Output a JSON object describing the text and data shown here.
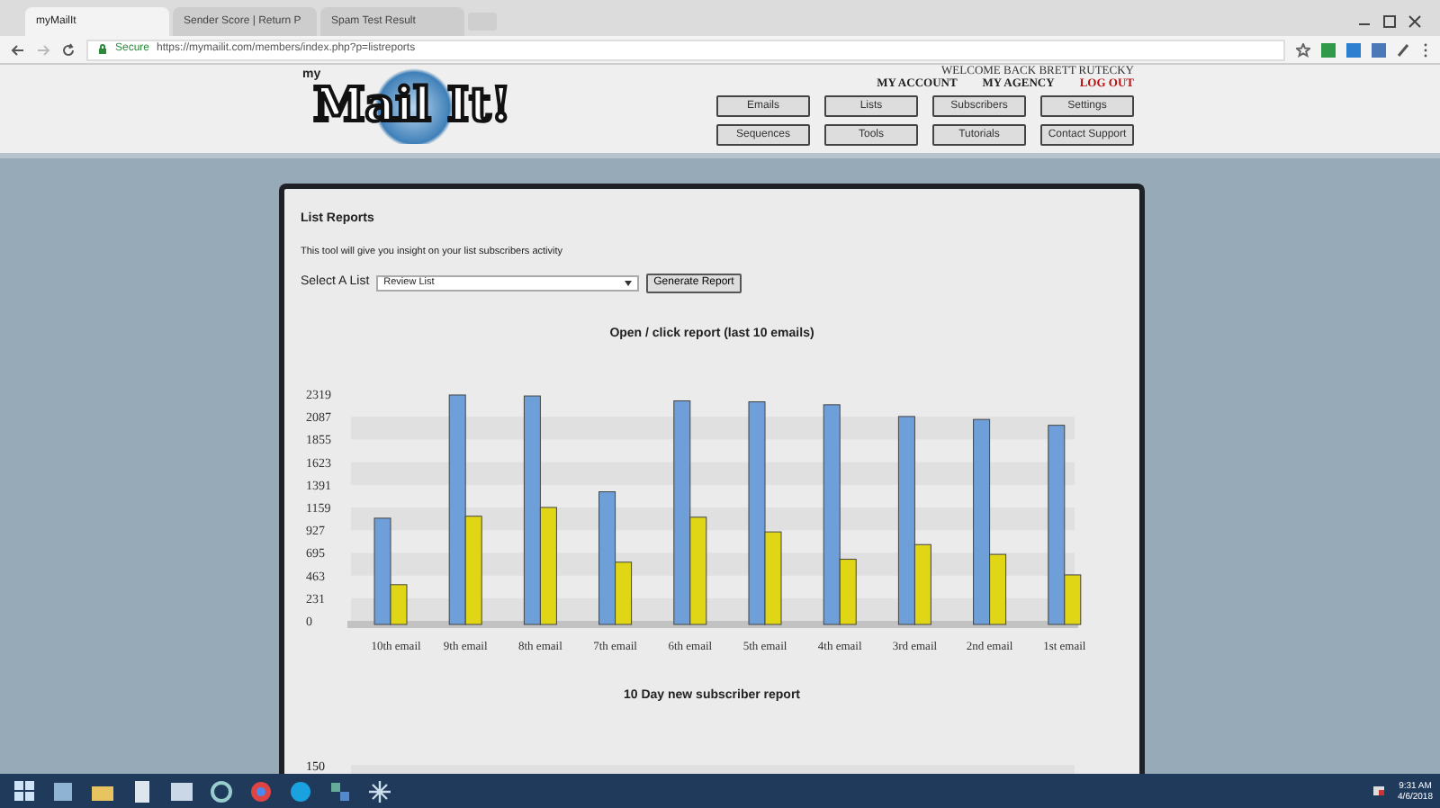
{
  "browser": {
    "tabs": [
      {
        "label": "myMailIt",
        "selected": true
      },
      {
        "label": "Sender Score | Return P",
        "selected": false
      },
      {
        "label": "Spam Test Result",
        "selected": false
      }
    ],
    "security": "Secure",
    "url": "https://mymailit.com/members/index.php?p=listreports"
  },
  "header": {
    "logo_small": "my",
    "logo": "Mail It!",
    "welcome": "WELCOME BACK BRETT RUTECKY",
    "links": [
      {
        "label": "MY ACCOUNT",
        "kind": "normal"
      },
      {
        "label": "MY AGENCY",
        "kind": "normal"
      },
      {
        "label": "LOG OUT",
        "kind": "logout"
      }
    ],
    "nav_buttons": [
      "Emails",
      "Lists",
      "Subscribers",
      "Settings",
      "Sequences",
      "Tools",
      "Tutorials",
      "Contact Support"
    ]
  },
  "panel": {
    "title": "List Reports",
    "description": "This tool will give you insight on your list subscribers activity",
    "select_label": "Select A List",
    "select_value": "Review List",
    "button": "Generate Report",
    "chart": {
      "title": "Open / click report (last 10 emails)",
      "chart_data": {
        "type": "bar",
        "categories": [
          "10th email",
          "9th email",
          "8th email",
          "7th email",
          "6th email",
          "5th email",
          "4th email",
          "3rd email",
          "2nd email",
          "1st email"
        ],
        "series": [
          {
            "color": "#6f9fd8",
            "values": [
              1050,
              2310,
              2300,
              1320,
              2250,
              2240,
              2210,
              2090,
              2060,
              2000
            ]
          },
          {
            "color": "#e0d616",
            "values": [
              370,
              1070,
              1160,
              600,
              1060,
              910,
              630,
              780,
              680,
              470
            ]
          }
        ],
        "ylim": [
          0,
          2319
        ],
        "yticks": [
          0,
          231,
          463,
          695,
          927,
          1159,
          1391,
          1623,
          1855,
          2087,
          2319
        ]
      }
    },
    "chart2": {
      "title": "10 Day new subscriber report",
      "axis_label": "150"
    }
  },
  "taskbar": {
    "time": "9:31 AM",
    "date": "4/6/2018"
  }
}
